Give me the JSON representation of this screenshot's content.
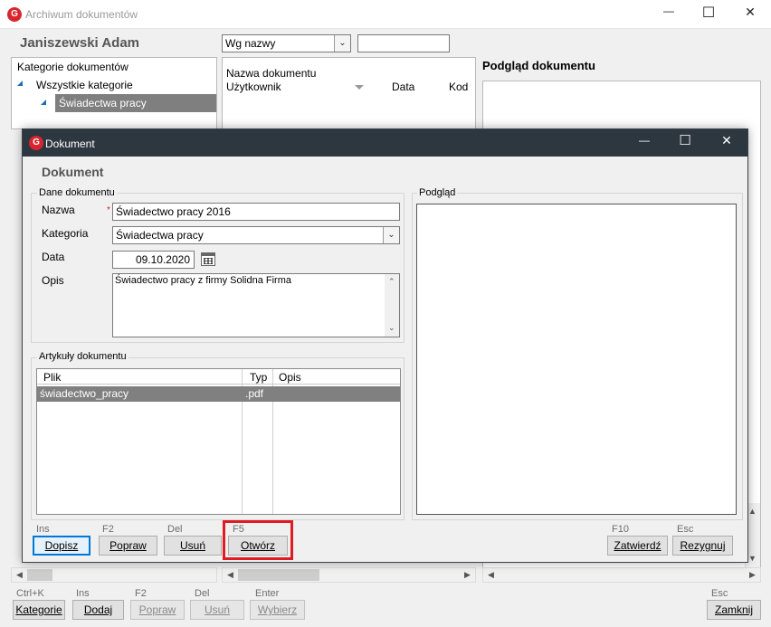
{
  "main_window": {
    "title": "Archiwum dokumentów",
    "logo_letter": "G",
    "controls": {
      "minimize": "—",
      "maximize": "☐",
      "close": "✕"
    },
    "person_name": "Janiszewski Adam",
    "sort_select": "Wg nazwy",
    "search_value": "",
    "categories": {
      "header": "Kategorie dokumentów",
      "items": [
        {
          "label": "Wszystkie kategorie"
        },
        {
          "label": "Świadectwa pracy"
        }
      ]
    },
    "list_columns": {
      "name": "Nazwa dokumentu",
      "user": "Użytkownik",
      "date": "Data",
      "code": "Kod"
    },
    "preview_title": "Podgląd dokumentu",
    "bottom_buttons": [
      {
        "shortcut": "Ctrl+K",
        "label": "Kategorie",
        "disabled": false
      },
      {
        "shortcut": "Ins",
        "label": "Dodaj",
        "disabled": false
      },
      {
        "shortcut": "F2",
        "label": "Popraw",
        "disabled": true
      },
      {
        "shortcut": "Del",
        "label": "Usuń",
        "disabled": true
      },
      {
        "shortcut": "Enter",
        "label": "Wybierz",
        "disabled": true
      }
    ],
    "close_button": {
      "shortcut": "Esc",
      "label": "Zamknij"
    }
  },
  "dialog": {
    "title": "Dokument",
    "logo_letter": "G",
    "controls": {
      "minimize": "—",
      "maximize": "☐",
      "close": "✕"
    },
    "heading": "Dokument",
    "details_group": "Dane dokumentu",
    "preview_group": "Podgląd",
    "fields": {
      "name_label": "Nazwa",
      "required_mark": "*",
      "name_value": "Świadectwo pracy 2016",
      "category_label": "Kategoria",
      "category_value": "Świadectwa pracy",
      "date_label": "Data",
      "date_value": "09.10.2020",
      "description_label": "Opis",
      "description_value": "Świadectwo pracy z firmy Solidna Firma"
    },
    "articles_group": "Artykuły dokumentu",
    "articles_columns": {
      "file": "Plik",
      "type": "Typ",
      "description": "Opis"
    },
    "articles_rows": [
      {
        "file": "świadectwo_pracy",
        "type": ".pdf",
        "description": ""
      }
    ],
    "buttons": [
      {
        "shortcut": "Ins",
        "label": "Dopisz"
      },
      {
        "shortcut": "F2",
        "label": "Popraw"
      },
      {
        "shortcut": "Del",
        "label": "Usuń"
      },
      {
        "shortcut": "F5",
        "label": "Otwórz"
      }
    ],
    "confirm_button": {
      "shortcut": "F10",
      "label": "Zatwierdź"
    },
    "cancel_button": {
      "shortcut": "Esc",
      "label": "Rezygnuj"
    }
  },
  "colors": {
    "accent_red": "#e01b24",
    "dialog_titlebar": "#2d3740",
    "selected_row": "#808080",
    "logo_red": "#d9262e"
  }
}
